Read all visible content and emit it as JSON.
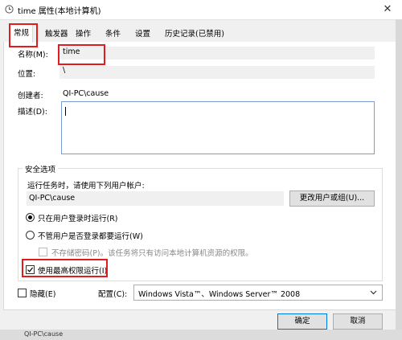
{
  "window": {
    "title": "time 属性(本地计算机)",
    "close_glyph": "✕"
  },
  "tabs": [
    {
      "label": "常规",
      "active": true
    },
    {
      "label": "触发器"
    },
    {
      "label": "操作"
    },
    {
      "label": "条件"
    },
    {
      "label": "设置"
    },
    {
      "label": "历史记录(已禁用)"
    }
  ],
  "general": {
    "name_label": "名称(M):",
    "name_value": "time",
    "location_label": "位置:",
    "location_value": "\\",
    "author_label": "创建者:",
    "author_value": "QI-PC\\cause",
    "description_label": "描述(D):",
    "description_value": ""
  },
  "security": {
    "group_title": "安全选项",
    "run_as_caption": "运行任务时，请使用下列用户帐户:",
    "run_as_user": "QI-PC\\cause",
    "change_user_button": "更改用户或组(U)...",
    "radio_logged_on": "只在用户登录时运行(R)",
    "radio_logged_on_selected": true,
    "radio_whether_logged": "不管用户是否登录都要运行(W)",
    "no_store_password": "不存储密码(P)。该任务将只有访问本地计算机资源的权限。",
    "highest_privileges": "使用最高权限运行(I)",
    "highest_privileges_checked": true
  },
  "footer": {
    "hidden_label": "隐藏(E)",
    "configure_label": "配置(C):",
    "configure_value": "Windows Vista™、Windows Server™ 2008",
    "ok_button": "确定",
    "cancel_button": "取消",
    "status_cut_text": "QI-PC\\cause"
  },
  "colors": {
    "highlight_box": "#e21c1c",
    "focus_border": "#7a9cd3"
  }
}
